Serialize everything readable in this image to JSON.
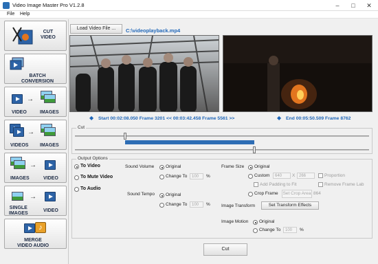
{
  "window": {
    "title": "Video Image Master Pro V1.2.8",
    "minimize": "–",
    "maximize": "□",
    "close": "✕"
  },
  "menu": [
    "File",
    "Help"
  ],
  "sidebar": {
    "cut_label": "CUT\nVIDEO",
    "batch_label": "BATCH\nCONVERSION",
    "v2i_from": "VIDEO",
    "v2i_to": "IMAGES",
    "vs2i_from": "VIDEOS",
    "vs2i_to": "IMAGES",
    "i2v_from": "IMAGES",
    "i2v_to": "VIDEO",
    "si2v_from": "SINGLE\nIMAGES",
    "si2v_to": "VIDEO",
    "merge_label": "MERGE\nVIDEO AUDIO"
  },
  "load": {
    "button": "Load Video File ...",
    "filename": "C:\\videoplayback.mp4"
  },
  "frames": {
    "start": "Start 00:02:08.050  Frame 3201 << 00:03:42.458  Frame 5561 >>",
    "end": "End 00:05:50.509  Frame 8762"
  },
  "cut": {
    "title": "Cut",
    "range_start": 0.17,
    "range_end": 0.61,
    "playhead": 0.61
  },
  "output": {
    "title": "Output Options",
    "to_video": "To Video",
    "to_mute": "To Mute Video",
    "to_audio": "To Audio",
    "sound_volume": "Sound Volume",
    "sound_tempo": "Sound Tempo",
    "original": "Original",
    "change_to": "Change To",
    "vol_value": "100",
    "tempo_value": "100",
    "pct": "%",
    "frame_size": "Frame Size",
    "custom": "Custom",
    "width": "640",
    "x": "X",
    "height": "266",
    "proportion": "Proportion",
    "add_padding": "Add Padding to Fit",
    "remove_frame": "Remove Frame Lab",
    "crop_frame": "Crop Frame",
    "set_crop": "Set Crop Area",
    "crop_value": "864",
    "image_transform": "Image Transform",
    "set_transform": "Set Transform Effects",
    "image_motion": "Image Motion",
    "motion_value": "100"
  },
  "action": {
    "cut": "Cut"
  }
}
